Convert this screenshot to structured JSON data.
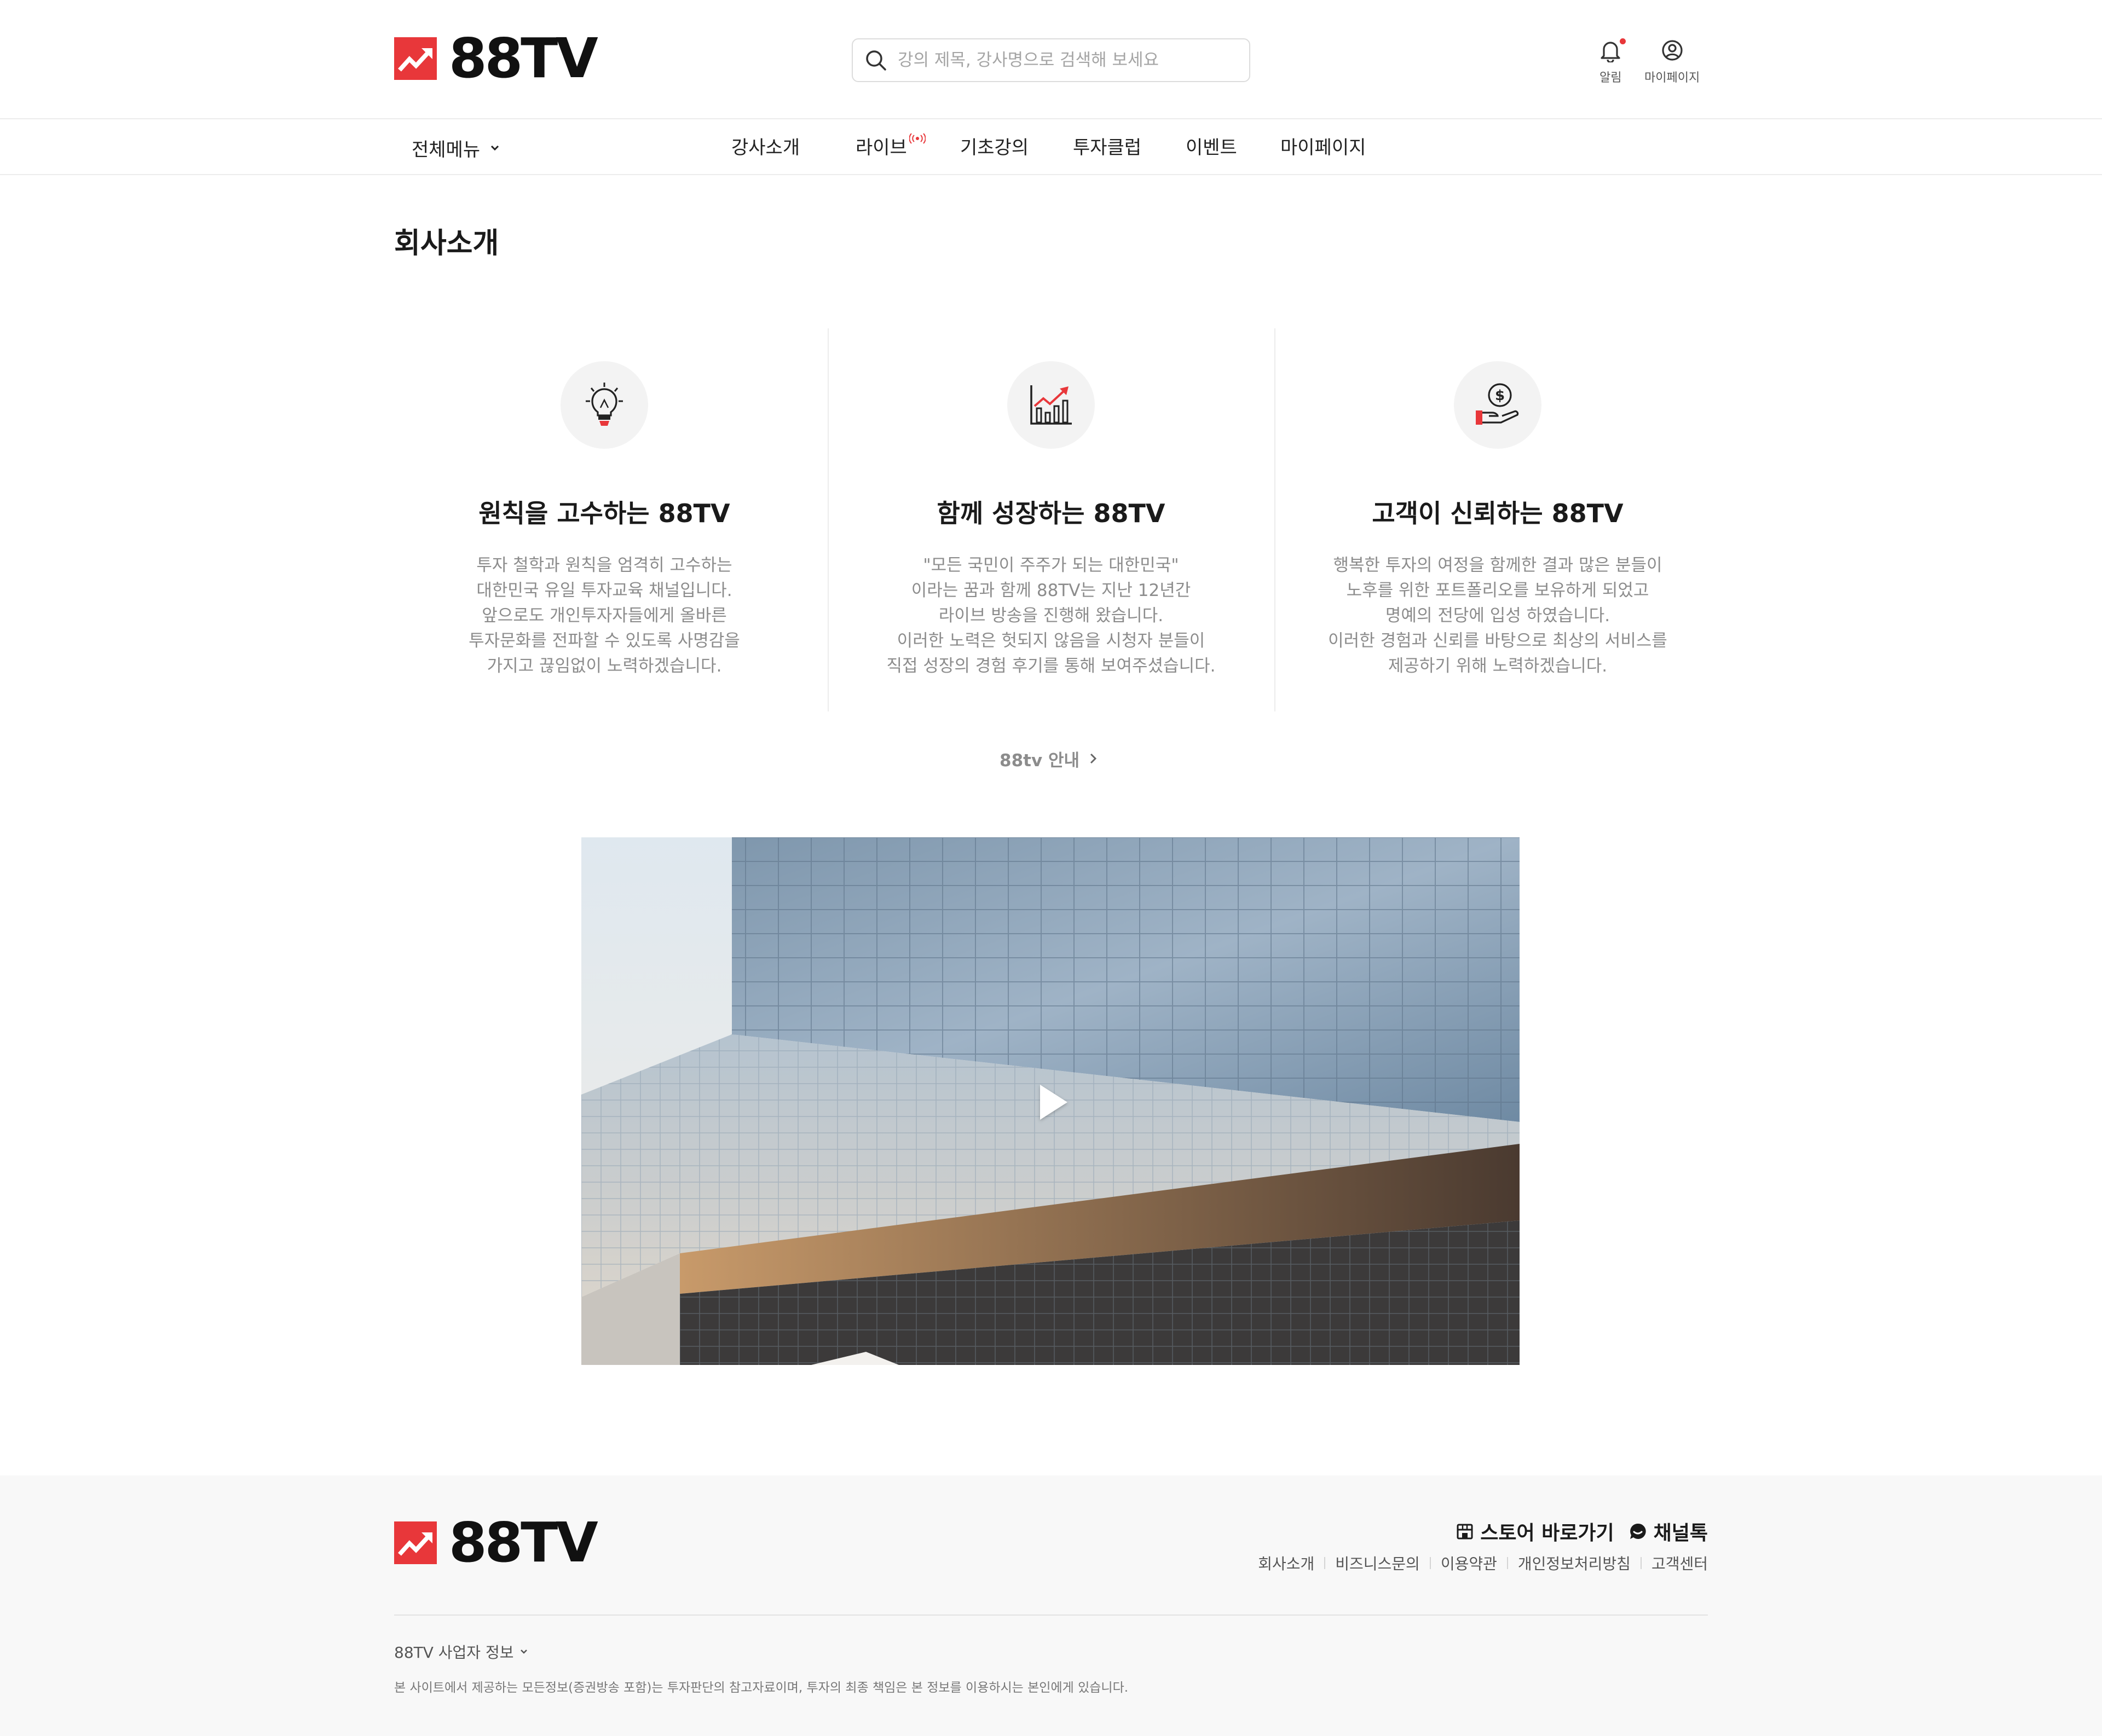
{
  "brand": {
    "name": "88TV",
    "accent_color": "#e8373a"
  },
  "header": {
    "search_placeholder": "강의 제목, 강사명으로 검색해 보세요",
    "utils": [
      {
        "label": "알림",
        "icon": "bell-icon",
        "has_dot": true
      },
      {
        "label": "마이페이지",
        "icon": "user-circle-icon"
      }
    ]
  },
  "nav": {
    "all_menu": "전체메뉴",
    "items": [
      "강사소개",
      "라이브",
      "기초강의",
      "투자클럽",
      "이벤트",
      "마이페이지"
    ]
  },
  "page": {
    "title": "회사소개"
  },
  "features": [
    {
      "icon": "lightbulb-icon",
      "title": "원칙을 고수하는 88TV",
      "lines": [
        "투자 철학과 원칙을 엄격히 고수하는",
        "대한민국 유일 투자교육 채널입니다.",
        "앞으로도 개인투자자들에게 올바른",
        "투자문화를 전파할 수 있도록 사명감을",
        "가지고 끊임없이 노력하겠습니다."
      ]
    },
    {
      "icon": "growth-chart-icon",
      "title": "함께 성장하는 88TV",
      "lines": [
        "\"모든 국민이 주주가 되는 대한민국\"",
        "이라는  꿈과 함께 88TV는 지난 12년간",
        "라이브 방송을 진행해 왔습니다.",
        "이러한 노력은 헛되지 않음을 시청자 분들이",
        "직접 성장의 경험 후기를 통해 보여주셨습니다."
      ]
    },
    {
      "icon": "money-hand-icon",
      "title": "고객이 신뢰하는 88TV",
      "lines": [
        "행복한 투자의 여정을 함께한 결과 많은 분들이",
        "노후를 위한 포트폴리오를 보유하게 되었고",
        "명예의 전당에 입성 하였습니다.",
        "이러한 경험과 신뢰를 바탕으로 최상의 서비스를",
        "제공하기 위해 노력하겠습니다."
      ]
    }
  ],
  "guide_link": "88tv 안내",
  "footer": {
    "quick": [
      {
        "label": "스토어 바로가기",
        "icon": "store-icon"
      },
      {
        "label": "채널톡",
        "icon": "chat-icon"
      }
    ],
    "links": [
      "회사소개",
      "비즈니스문의",
      "이용약관",
      "개인정보처리방침",
      "고객센터"
    ],
    "biz_info": "88TV 사업자 정보",
    "disclaimer": "본 사이트에서 제공하는 모든정보(증권방송 포함)는 투자판단의 참고자료이며, 투자의 최종 책임은 본 정보를 이용하시는 본인에게 있습니다."
  }
}
